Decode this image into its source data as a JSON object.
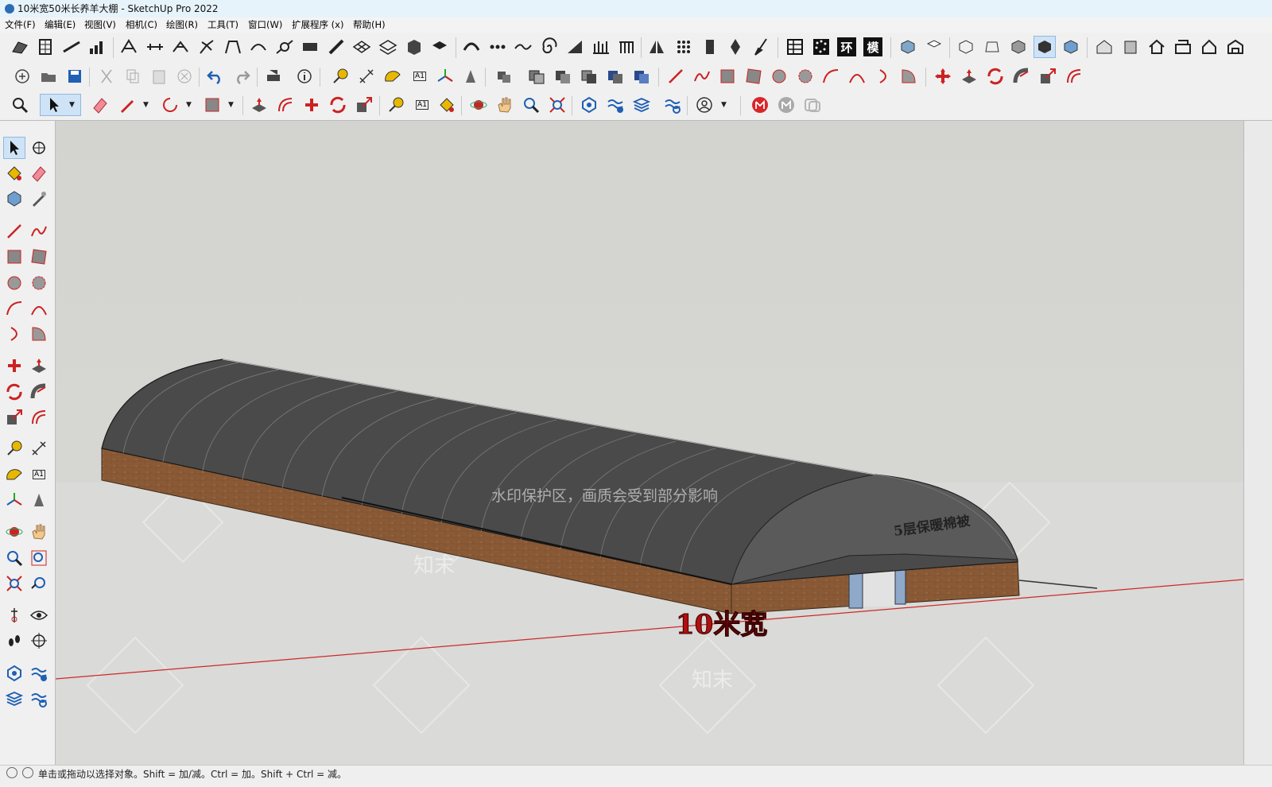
{
  "window": {
    "title": "10米宽50米长养羊大棚 - SketchUp Pro 2022"
  },
  "menu": [
    "文件(F)",
    "编辑(E)",
    "视图(V)",
    "相机(C)",
    "绘图(R)",
    "工具(T)",
    "窗口(W)",
    "扩展程序 (x)",
    "帮助(H)"
  ],
  "toolbar_text": {
    "ring": "环",
    "mo": "模",
    "a1": "A1"
  },
  "viewport": {
    "dimension_label": "10米宽",
    "end_label": "5层保暖棉被",
    "watermark_text": "水印保护区，画质会受到部分影响",
    "watermark_logo": "知末",
    "colors": {
      "sky": "#d3d3cf",
      "roof": "#4a4a4a",
      "brick": "#8a5a36",
      "axis_red": "#cc2a2a",
      "dimension_red": "#b01010"
    }
  },
  "statusbar": {
    "hint": "单击或拖动以选择对象。Shift = 加/减。Ctrl = 加。Shift + Ctrl = 减。"
  }
}
